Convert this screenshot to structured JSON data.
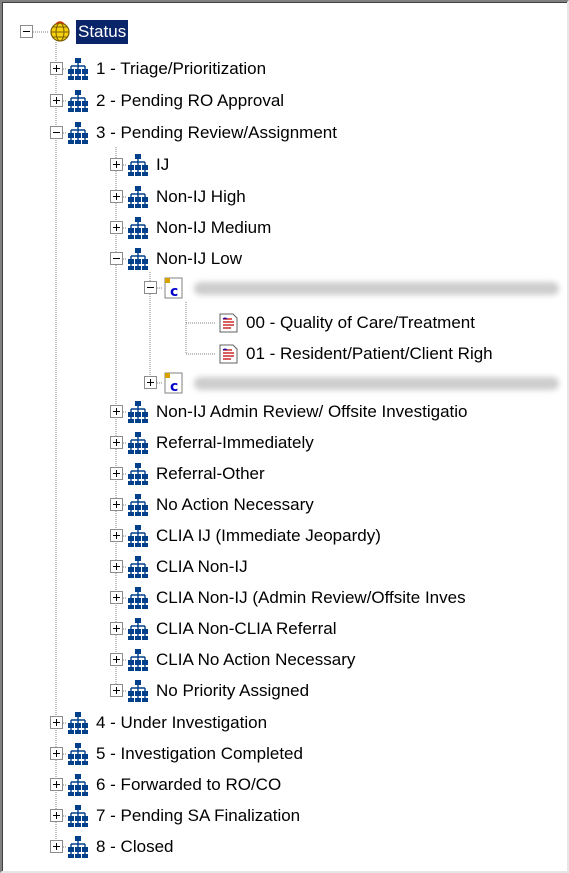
{
  "tree": {
    "root": {
      "label": "Status",
      "icon": "status-globe-icon",
      "expanded": true,
      "selected": true
    },
    "statuses": [
      {
        "label": "1 - Triage/Prioritization",
        "icon": "org-hierarchy-icon",
        "expanded": false
      },
      {
        "label": "2 - Pending RO Approval",
        "icon": "org-hierarchy-icon",
        "expanded": false
      },
      {
        "label": "3 - Pending Review/Assignment",
        "icon": "org-hierarchy-icon",
        "expanded": true,
        "priorities": [
          {
            "label": "IJ",
            "icon": "org-hierarchy-icon",
            "expanded": false
          },
          {
            "label": "Non-IJ High",
            "icon": "org-hierarchy-icon",
            "expanded": false
          },
          {
            "label": "Non-IJ Medium",
            "icon": "org-hierarchy-icon",
            "expanded": false
          },
          {
            "label": "Non-IJ Low",
            "icon": "org-hierarchy-icon",
            "expanded": true,
            "cases": [
              {
                "icon": "complaint-case-icon",
                "label_redacted": true,
                "expanded": true,
                "allegations": [
                  {
                    "label": "00 - Quality of Care/Treatment",
                    "icon": "allegation-document-icon"
                  },
                  {
                    "label": "01 - Resident/Patient/Client Righ",
                    "icon": "allegation-document-icon"
                  }
                ]
              },
              {
                "icon": "complaint-case-icon",
                "label_redacted": true,
                "expanded": false
              }
            ]
          },
          {
            "label": "Non-IJ Admin Review/ Offsite Investigatio",
            "icon": "org-hierarchy-icon",
            "expanded": false
          },
          {
            "label": "Referral-Immediately",
            "icon": "org-hierarchy-icon",
            "expanded": false
          },
          {
            "label": "Referral-Other",
            "icon": "org-hierarchy-icon",
            "expanded": false
          },
          {
            "label": "No Action Necessary",
            "icon": "org-hierarchy-icon",
            "expanded": false
          },
          {
            "label": "CLIA IJ (Immediate Jeopardy)",
            "icon": "org-hierarchy-icon",
            "expanded": false
          },
          {
            "label": "CLIA Non-IJ",
            "icon": "org-hierarchy-icon",
            "expanded": false
          },
          {
            "label": "CLIA Non-IJ (Admin Review/Offsite Inves",
            "icon": "org-hierarchy-icon",
            "expanded": false
          },
          {
            "label": "CLIA Non-CLIA Referral",
            "icon": "org-hierarchy-icon",
            "expanded": false
          },
          {
            "label": "CLIA No Action Necessary",
            "icon": "org-hierarchy-icon",
            "expanded": false
          },
          {
            "label": "No Priority Assigned",
            "icon": "org-hierarchy-icon",
            "expanded": false
          }
        ]
      },
      {
        "label": "4 - Under Investigation",
        "icon": "org-hierarchy-icon",
        "expanded": false
      },
      {
        "label": "5 - Investigation Completed",
        "icon": "org-hierarchy-icon",
        "expanded": false
      },
      {
        "label": "6 - Forwarded to RO/CO",
        "icon": "org-hierarchy-icon",
        "expanded": false
      },
      {
        "label": "7 - Pending SA Finalization",
        "icon": "org-hierarchy-icon",
        "expanded": false
      },
      {
        "label": "8 - Closed",
        "icon": "org-hierarchy-icon",
        "expanded": false
      }
    ]
  },
  "colors": {
    "selection_background": "#0a246a",
    "selection_text": "#ffffff",
    "hierarchy_icon": "#003f8a",
    "case_icon_letter": "#0000c8",
    "allegation_icon_lines": "#c00000"
  }
}
